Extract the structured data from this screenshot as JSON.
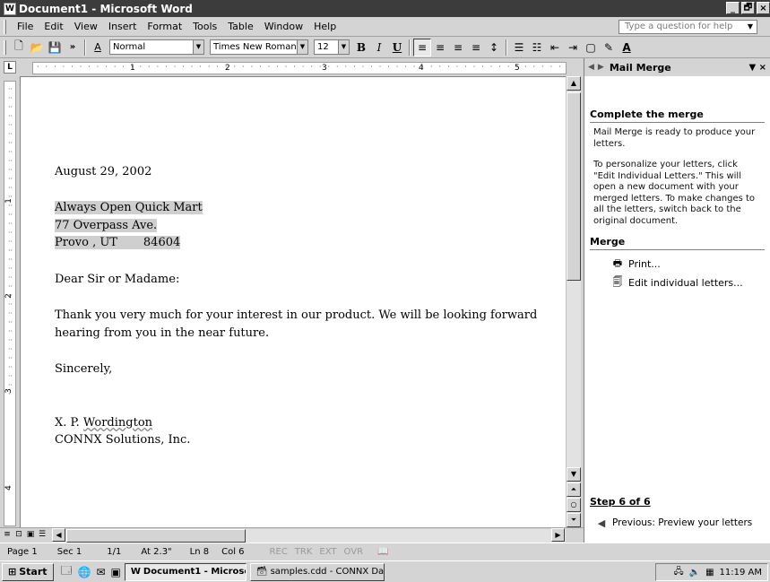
{
  "window": {
    "title": "Document1 - Microsoft Word",
    "icon": "word-doc-icon",
    "controls": [
      "_",
      "🗗",
      "×"
    ]
  },
  "menu": {
    "items": [
      "File",
      "Edit",
      "View",
      "Insert",
      "Format",
      "Tools",
      "Table",
      "Window",
      "Help"
    ],
    "help_placeholder": "Type a question for help"
  },
  "toolbar": {
    "style": "Normal",
    "font": "Times New Roman",
    "size": "12",
    "bold": "B",
    "italic": "I",
    "underline": "U"
  },
  "ruler": {
    "labels": [
      "1",
      "2",
      "3",
      "4",
      "5"
    ]
  },
  "vruler": {
    "labels": [
      "1",
      "2",
      "3",
      "4"
    ]
  },
  "document": {
    "date": "August 29, 2002",
    "address1": "Always Open Quick Mart",
    "address2": "77 Overpass Ave.",
    "address3": "Provo , UT       84604",
    "salutation": "Dear Sir or Madame:",
    "body1": "Thank you very much for your interest in our product. We will be looking forward",
    "body2": "hearing from you in the near future.",
    "closing": "Sincerely,",
    "sig_prefix": "X. P. ",
    "sig_name": "Wordington",
    "company": "CONNX Solutions, Inc."
  },
  "pane": {
    "title": "Mail Merge",
    "section1": "Complete the merge",
    "p1": "Mail Merge is ready to produce your letters.",
    "p2": "To personalize your letters, click \"Edit Individual Letters.\" This will open a new document with your merged letters. To make changes to all the letters, switch back to the original document.",
    "section2": "Merge",
    "print_link": "Print...",
    "edit_link": "Edit individual letters...",
    "step": "Step 6 of 6",
    "prev_link": "Previous: Preview your letters"
  },
  "status": {
    "page": "Page 1",
    "sec": "Sec 1",
    "pages": "1/1",
    "at": "At 2.3\"",
    "ln": "Ln 8",
    "col": "Col 6",
    "rec": "REC",
    "trk": "TRK",
    "ext": "EXT",
    "ovr": "OVR"
  },
  "taskbar": {
    "start": "Start",
    "task1": "Document1 - Microsof...",
    "task2": "samples.cdd - CONNX Dat...",
    "clock": "11:19 AM"
  }
}
